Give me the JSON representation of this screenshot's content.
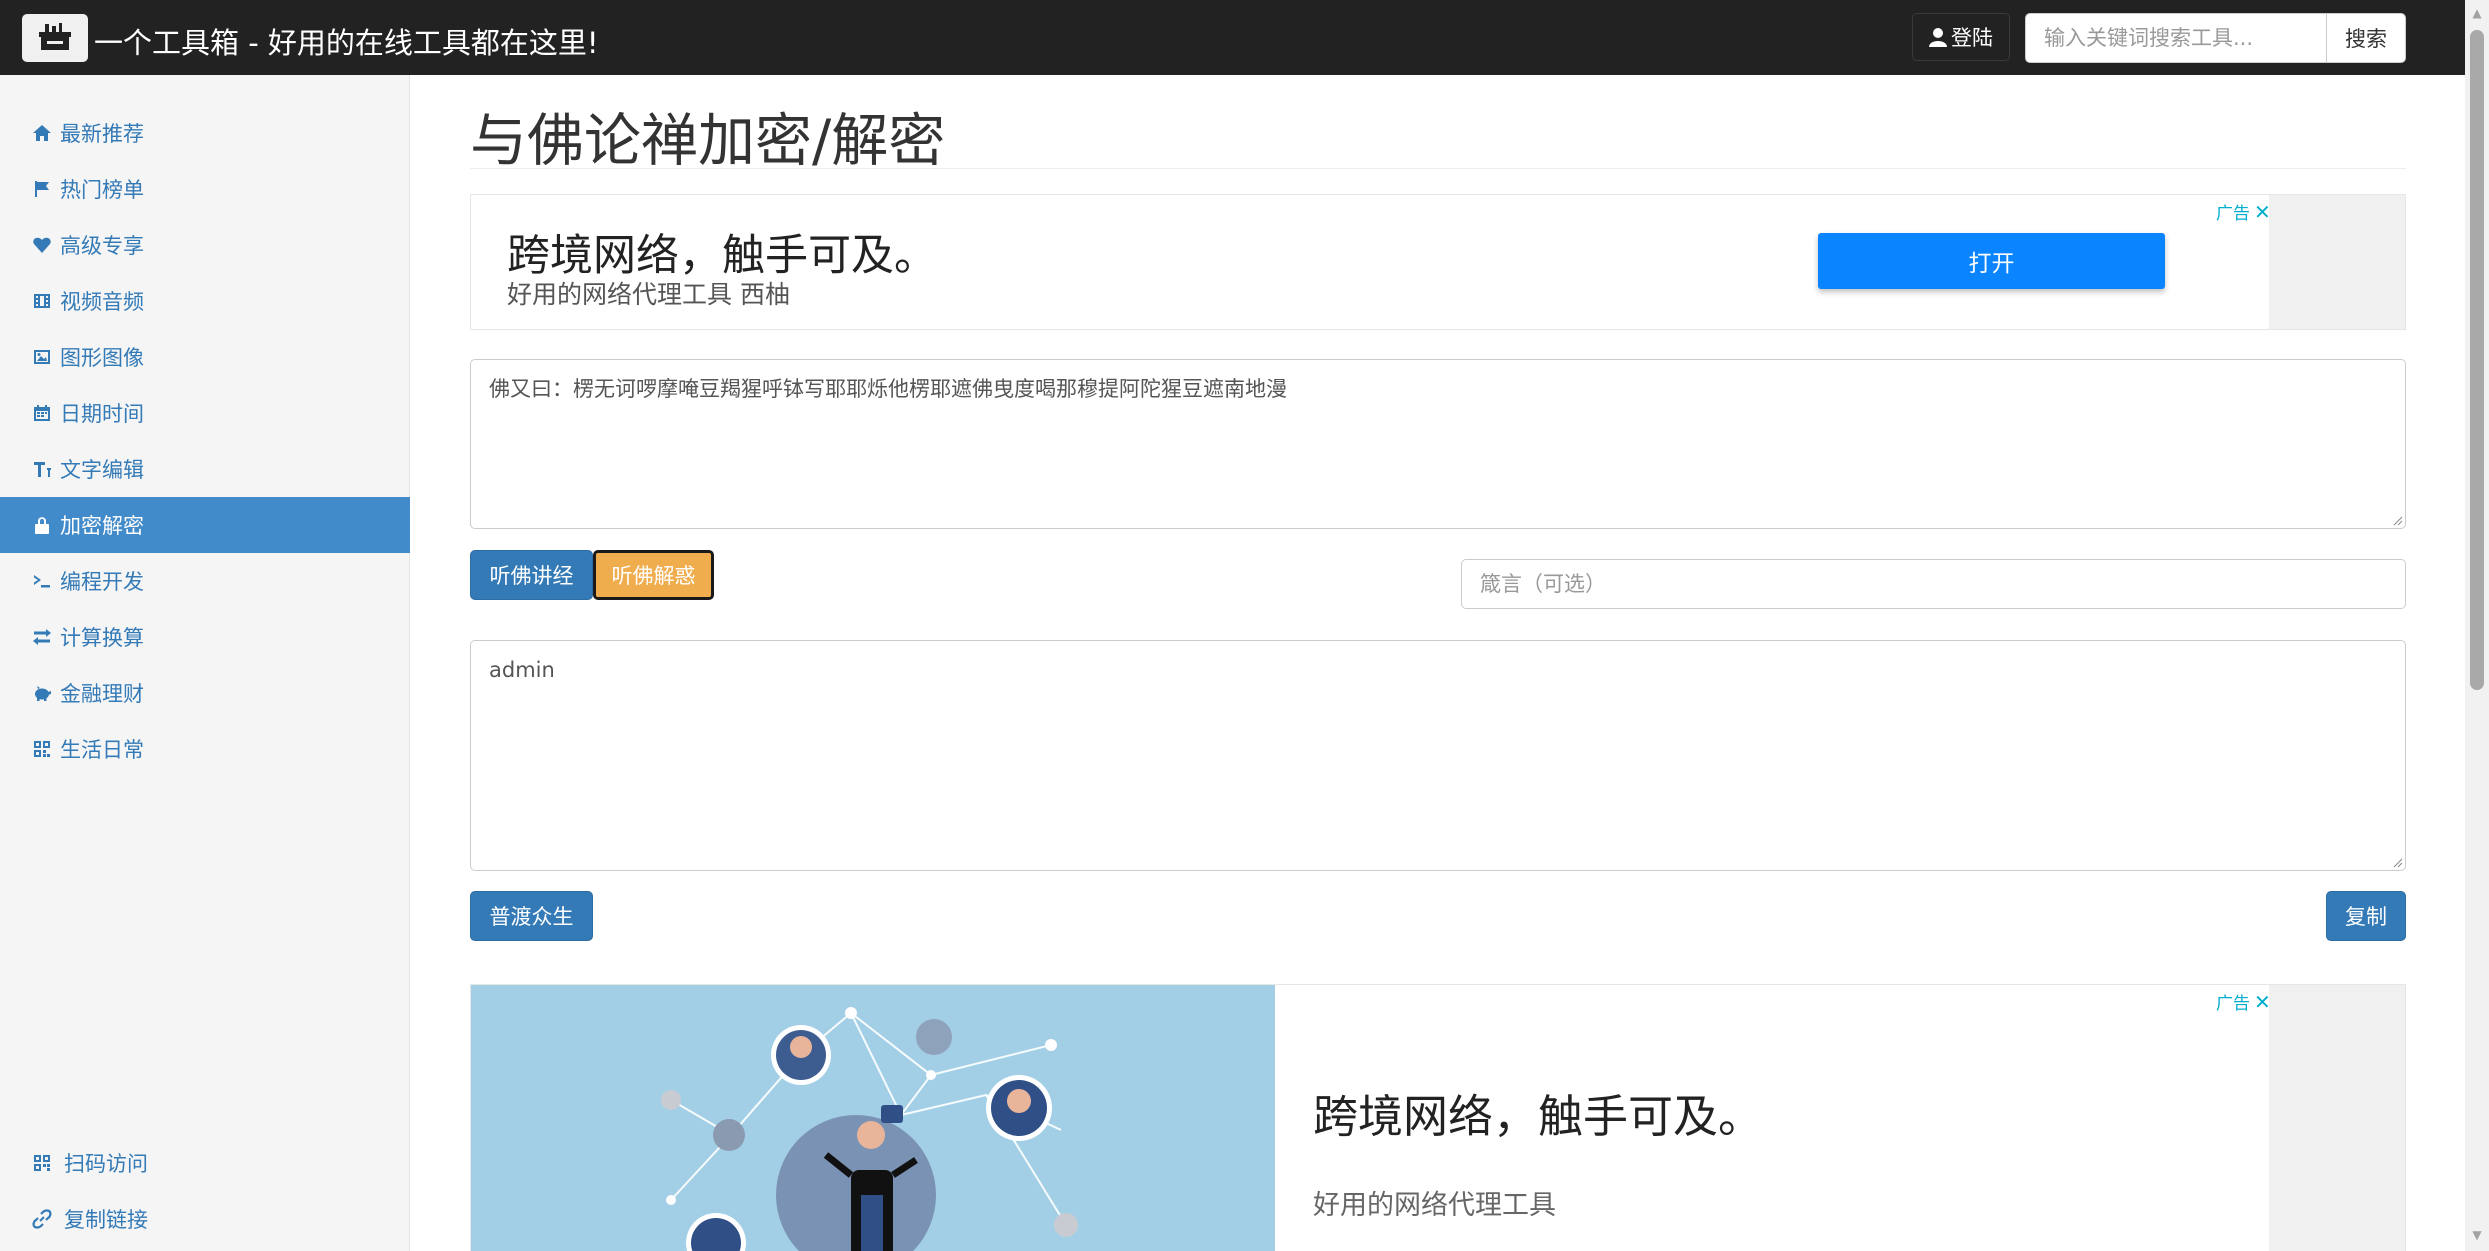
{
  "navbar": {
    "brand_icon": "toolbox-logo-icon",
    "title": "一个工具箱 - 好用的在线工具都在这里!",
    "login_label": "登陆",
    "search_placeholder": "输入关键词搜索工具...",
    "search_button": "搜索"
  },
  "sidebar": {
    "items": [
      {
        "label": "最新推荐",
        "icon": "home-icon"
      },
      {
        "label": "热门榜单",
        "icon": "flag-icon"
      },
      {
        "label": "高级专享",
        "icon": "heart-icon"
      },
      {
        "label": "视频音频",
        "icon": "film-icon"
      },
      {
        "label": "图形图像",
        "icon": "picture-icon"
      },
      {
        "label": "日期时间",
        "icon": "calendar-icon"
      },
      {
        "label": "文字编辑",
        "icon": "text-height-icon"
      },
      {
        "label": "加密解密",
        "icon": "lock-icon",
        "active": true
      },
      {
        "label": "编程开发",
        "icon": "terminal-icon"
      },
      {
        "label": "计算换算",
        "icon": "transfer-icon"
      },
      {
        "label": "金融理财",
        "icon": "piggy-bank-icon"
      },
      {
        "label": "生活日常",
        "icon": "qrcode-grid-icon"
      }
    ],
    "bottom_items": [
      {
        "label": "扫码访问",
        "icon": "qrcode-icon"
      },
      {
        "label": "复制链接",
        "icon": "link-icon"
      }
    ]
  },
  "main": {
    "title": "与佛论禅加密/解密",
    "ad_top": {
      "tag": "广告",
      "headline": "跨境网络，触手可及。",
      "subtext": "好用的网络代理工具 西柚",
      "button": "打开"
    },
    "cipher_text": "佛又曰：楞无诃啰摩唵豆羯猩呼钵写耶耶烁他楞耶遮佛曳度喝那穆提阿陀猩豆遮南地漫",
    "encrypt_button": "听佛讲经",
    "decrypt_button": "听佛解惑",
    "key_placeholder": "箴言（可选）",
    "plain_text": "admin",
    "convert_button": "普渡众生",
    "copy_button": "复制",
    "ad_bottom": {
      "tag": "广告",
      "headline": "跨境网络，触手可及。",
      "subtext": "好用的网络代理工具"
    }
  },
  "colors": {
    "navbar_bg": "#222222",
    "primary": "#337ab7",
    "sidebar_active": "#428bca",
    "warning": "#f0ad4e",
    "ad_button": "#0a84ff"
  }
}
